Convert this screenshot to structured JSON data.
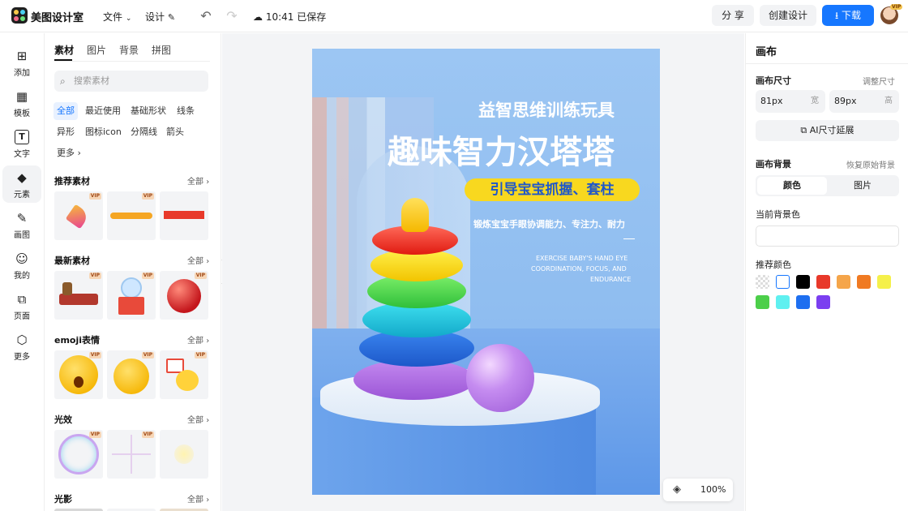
{
  "app": {
    "brand": "美图设计室"
  },
  "topbar": {
    "menu_file": "文件",
    "menu_design": "设计",
    "save_status": "10:41 已保存",
    "share_label": "分 享",
    "create_label": "创建设计",
    "download_label": "下载",
    "vip_badge": "VIP"
  },
  "leftnav": {
    "items": [
      {
        "label": "添加"
      },
      {
        "label": "模板"
      },
      {
        "label": "文字"
      },
      {
        "label": "元素"
      },
      {
        "label": "画图"
      },
      {
        "label": "我的"
      },
      {
        "label": "页面"
      },
      {
        "label": "更多"
      }
    ]
  },
  "panel": {
    "tabs": [
      "素材",
      "图片",
      "背景",
      "拼图"
    ],
    "search_placeholder": "搜索素材",
    "chips": [
      "全部",
      "最近使用",
      "基础形状",
      "线条",
      "异形",
      "图标icon",
      "分隔线",
      "箭头",
      "更多"
    ],
    "sections": [
      {
        "title": "推荐素材",
        "all": "全部"
      },
      {
        "title": "最新素材",
        "all": "全部"
      },
      {
        "title": "emoji表情",
        "all": "全部"
      },
      {
        "title": "光效",
        "all": "全部"
      },
      {
        "title": "光影",
        "all": "全部"
      }
    ],
    "vip": "VIP"
  },
  "poster": {
    "subtitle": "益智思维训练玩具",
    "title": "趣味智力汉塔塔",
    "banner": "引导宝宝抓握、套柱",
    "desc_cn": "锻炼宝宝手眼协调能力、专注力、耐力",
    "desc_en_1": "EXERCISE BABY'S HAND EYE",
    "desc_en_2": "COORDINATION, FOCUS, AND",
    "desc_en_3": "ENDURANCE"
  },
  "zoom": {
    "level": "100%"
  },
  "rightpanel": {
    "title": "画布",
    "size_label": "画布尺寸",
    "adjust_link": "调整尺寸",
    "width_value": "81px",
    "width_unit": "宽",
    "height_value": "89px",
    "height_unit": "高",
    "ai_button": "AI尺寸延展",
    "bg_label": "画布背景",
    "restore_link": "恢复原始背景",
    "seg_color": "颜色",
    "seg_image": "图片",
    "current_bg_label": "当前背景色",
    "recommended_label": "推荐颜色",
    "swatches": [
      "transparent",
      "#ffffff",
      "#000000",
      "#e8392a",
      "#f5a54a",
      "#f07a22",
      "#f5f04a",
      "#4ccf4a",
      "#5ff0f0",
      "#1e6ff0",
      "#7b3ff0"
    ]
  }
}
